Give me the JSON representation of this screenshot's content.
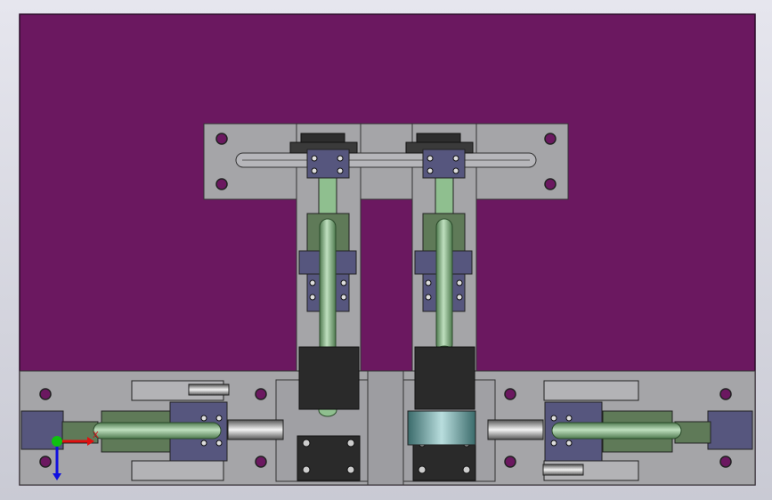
{
  "viewport": {
    "background_top": "#e6e6ee",
    "background_bottom": "#c9cad4"
  },
  "model": {
    "base_plate_color": "#6b1860",
    "fixture_plate_color": "#a5a5a8",
    "rod_color": "#8fbf8f",
    "cylinder_color": "#5f7a58",
    "bracket_color": "#56567e",
    "block_color": "#2a2a2a",
    "hole_color": "#6b1860"
  },
  "triad": {
    "x_label": "X",
    "x_color": "#e01010",
    "y_color": "#10c010",
    "z_color": "#1010e0"
  }
}
